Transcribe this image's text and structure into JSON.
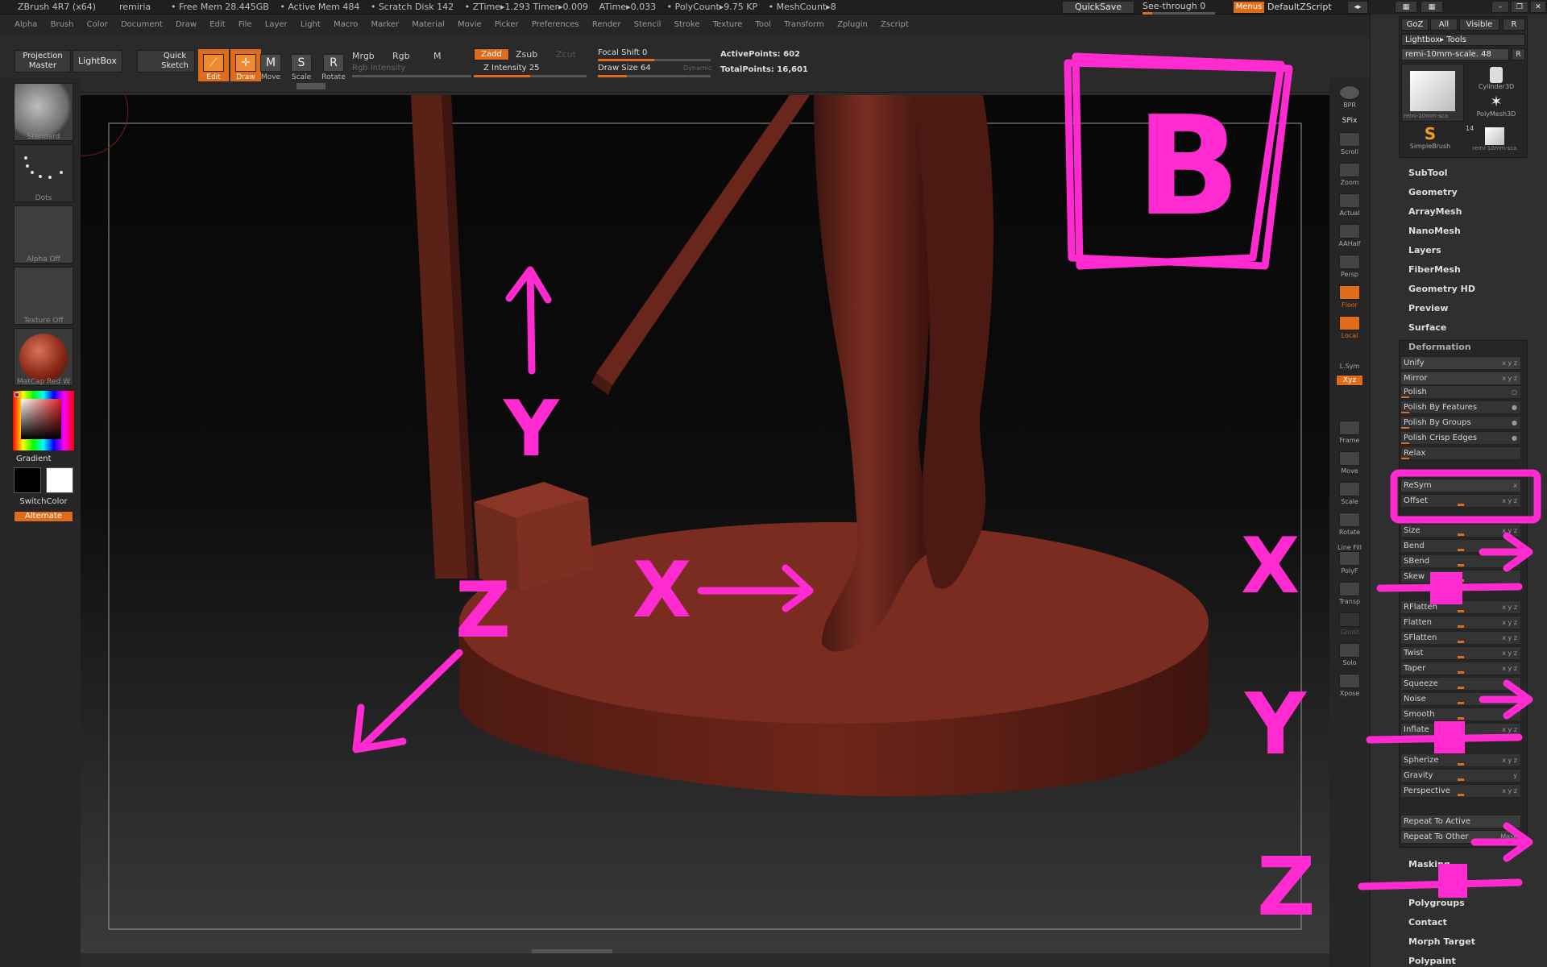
{
  "titlebar": {
    "app": "ZBrush 4R7 (x64)",
    "doc": "remiria",
    "status": [
      "• Free Mem 28.445GB",
      "• Active Mem 484",
      "• Scratch Disk 142",
      "• ZTime▸1.293 Timer▸0.009",
      "ATime▸0.033",
      "• PolyCount▸9.75 KP",
      "• MeshCount▸8"
    ],
    "quicksave": "QuickSave",
    "seethrough": "See-through   0",
    "menus": "Menus",
    "script": "DefaultZScript"
  },
  "menubar": [
    "Alpha",
    "Brush",
    "Color",
    "Document",
    "Draw",
    "Edit",
    "File",
    "Layer",
    "Light",
    "Macro",
    "Marker",
    "Material",
    "Movie",
    "Picker",
    "Preferences",
    "Render",
    "Stencil",
    "Stroke",
    "Texture",
    "Tool",
    "Transform",
    "Zplugin",
    "Zscript"
  ],
  "toolbar": {
    "projection_master": "Projection Master",
    "lightbox": "LightBox",
    "quick_sketch": "Quick Sketch",
    "edit": "Edit",
    "draw": "Draw",
    "move": "Move",
    "scale": "Scale",
    "rotate": "Rotate",
    "mrgb": "Mrgb",
    "rgb": "Rgb",
    "m": "M",
    "rgb_intensity": "Rgb Intensity",
    "zadd": "Zadd",
    "zsub": "Zsub",
    "zcut": "Zcut",
    "z_intensity": "Z Intensity 25",
    "focal_shift": "Focal Shift 0",
    "draw_size": "Draw Size 64",
    "dynamic": "Dynamic",
    "active_points": "ActivePoints: 602",
    "total_points": "TotalPoints: 16,601"
  },
  "leftshelf": {
    "brush": "Standard",
    "stroke": "Dots",
    "alpha": "Alpha Off",
    "texture": "Texture Off",
    "material": "MatCap Red W",
    "gradient": "Gradient",
    "switchcolor": "SwitchColor",
    "alternate": "Alternate"
  },
  "rightshelf": [
    "BPR",
    "SPix",
    "Scroll",
    "Zoom",
    "Actual",
    "AAHalf",
    "Persp",
    "Floor",
    "Local",
    "L.Sym",
    "Xyz",
    "Frame",
    "Move",
    "Scale",
    "Rotate",
    "Line Fill",
    "PolyF",
    "Transp",
    "Ghost",
    "Solo",
    "Xpose"
  ],
  "tray": {
    "goz": "GoZ",
    "all": "All",
    "visible": "Visible",
    "r": "R",
    "lightbox_tools": "Lightbox▸ Tools",
    "current_tool": "remi-10mm-scale. 48",
    "tool_thumbs": [
      "remi-10mm-sca",
      "Cylinder3D",
      "PolyMesh3D",
      "SimpleBrush",
      "remi-10mm-sca"
    ],
    "thumb_badge": "14",
    "menus": [
      "SubTool",
      "Geometry",
      "ArrayMesh",
      "NanoMesh",
      "Layers",
      "FiberMesh",
      "Geometry HD",
      "Preview",
      "Surface"
    ],
    "deformation_title": "Deformation",
    "deformation": [
      "Unify",
      "Mirror",
      "Polish",
      "Polish By Features",
      "Polish By Groups",
      "Polish Crisp Edges",
      "Relax",
      "ReSym",
      "Offset",
      "Size",
      "Bend",
      "SBend",
      "Skew",
      "RFlatten",
      "Flatten",
      "SFlatten",
      "Twist",
      "Taper",
      "Squeeze",
      "Noise",
      "Smooth",
      "Inflate",
      "Spherize",
      "Gravity",
      "Perspective",
      "Repeat To Active",
      "Repeat To Other"
    ],
    "mask_right": "Mask",
    "lower_menus": [
      "Masking",
      "Polygroups",
      "Contact",
      "Morph Target",
      "Polypaint"
    ]
  },
  "annotations": {
    "box_letter": "B",
    "labels": [
      "Y",
      "X",
      "Z",
      "X",
      "Y",
      "Z"
    ]
  },
  "colors": {
    "accent": "#e06c1a",
    "annotation": "#ff2ad0",
    "model": "#7a2e22"
  }
}
